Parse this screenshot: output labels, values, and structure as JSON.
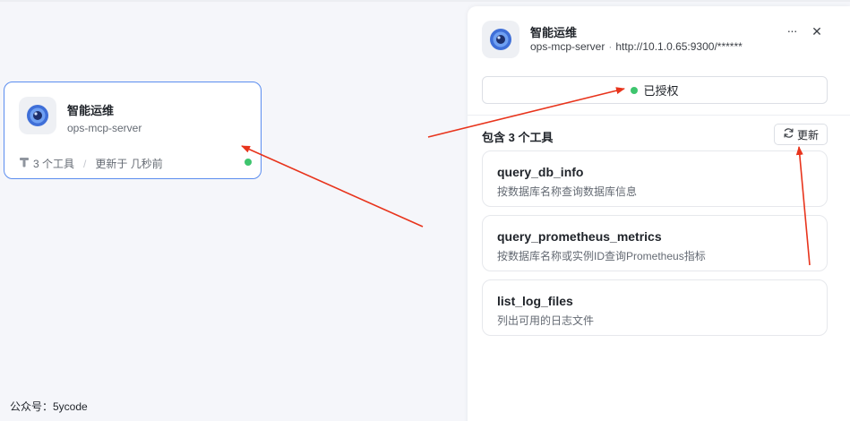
{
  "server_card": {
    "title": "智能运维",
    "subtitle": "ops-mcp-server",
    "tools_count": "3 个工具",
    "updated": "更新于 几秒前",
    "status_color": "#3ec56e"
  },
  "watermark": "公众号：5ycode",
  "panel": {
    "title": "智能运维",
    "server_name": "ops-mcp-server",
    "url": "http://10.1.0.65:9300/******",
    "more_label": "···",
    "close_label": "✕",
    "auth_label": "已授权",
    "tools_heading": "包含 3 个工具",
    "refresh_label": "更新",
    "tools": [
      {
        "name": "query_db_info",
        "desc": "按数据库名称查询数据库信息"
      },
      {
        "name": "query_prometheus_metrics",
        "desc": "按数据库名称或实例ID查询Prometheus指标"
      },
      {
        "name": "list_log_files",
        "desc": "列出可用的日志文件"
      }
    ]
  },
  "colors": {
    "accent_border": "#5b8def",
    "status_green": "#3ec56e",
    "annotation_arrow": "#e8341c"
  },
  "icons": [
    "app-logo-icon",
    "tool-icon",
    "more-icon",
    "close-icon",
    "refresh-icon"
  ]
}
